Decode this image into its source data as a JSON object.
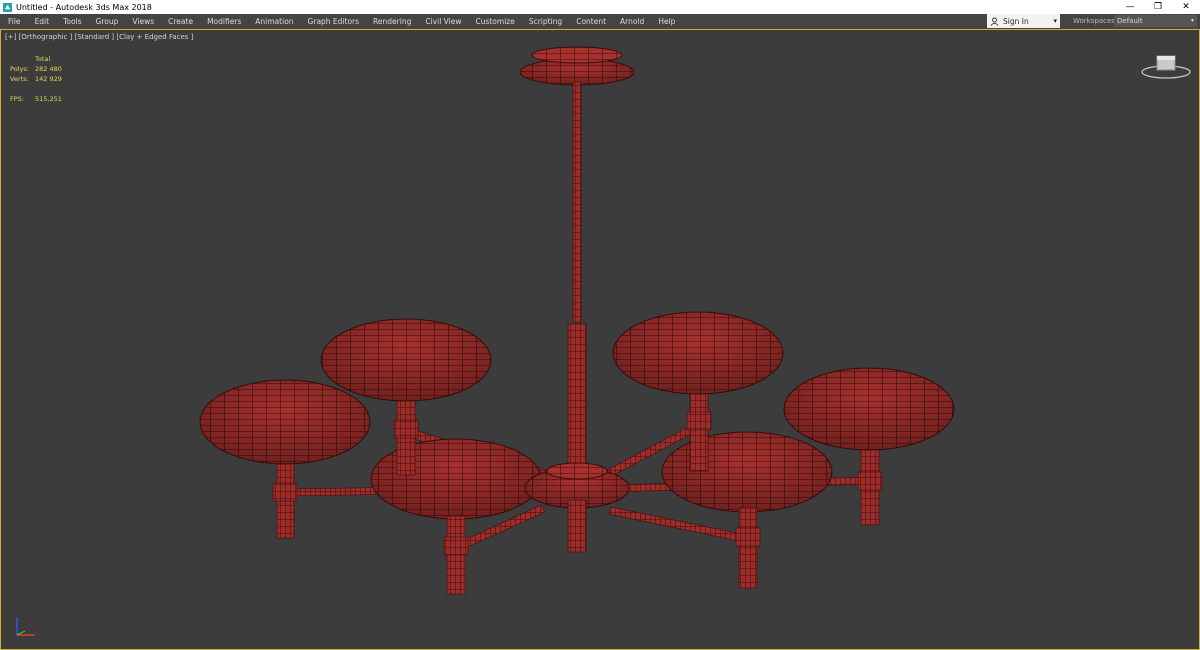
{
  "window": {
    "title": "Untitled - Autodesk 3ds Max 2018",
    "minimize_glyph": "—",
    "restore_glyph": "❐",
    "close_glyph": "✕"
  },
  "menu": [
    "File",
    "Edit",
    "Tools",
    "Group",
    "Views",
    "Create",
    "Modifiers",
    "Animation",
    "Graph Editors",
    "Rendering",
    "Civil View",
    "Customize",
    "Scripting",
    "Content",
    "Arnold",
    "Help"
  ],
  "signin": {
    "label": "Sign In",
    "caret": "▾"
  },
  "workspaces": {
    "label": "Workspaces:",
    "value": "Default",
    "caret": "▾"
  },
  "viewport": {
    "label": "[+] [Orthographic ] [Standard ] [Clay + Edged Faces ]",
    "stats": {
      "header": "Total",
      "polys_label": "Polys:",
      "polys_value": "282 480",
      "verts_label": "Verts:",
      "verts_value": "142 929",
      "fps_label": "FPS:",
      "fps_value": "515,251"
    }
  },
  "colors": {
    "viewport_bg": "#3c3c3c",
    "model_red": "#a8312e",
    "wire": "#3a0d0c",
    "stats_yellow": "#e0dc52",
    "active_border": "#c9b12a"
  },
  "icons": {
    "app": "3dsmax-logo-icon",
    "user": "user-icon",
    "viewcube": "viewcube-icon",
    "axis": "axis-tripod-icon"
  }
}
